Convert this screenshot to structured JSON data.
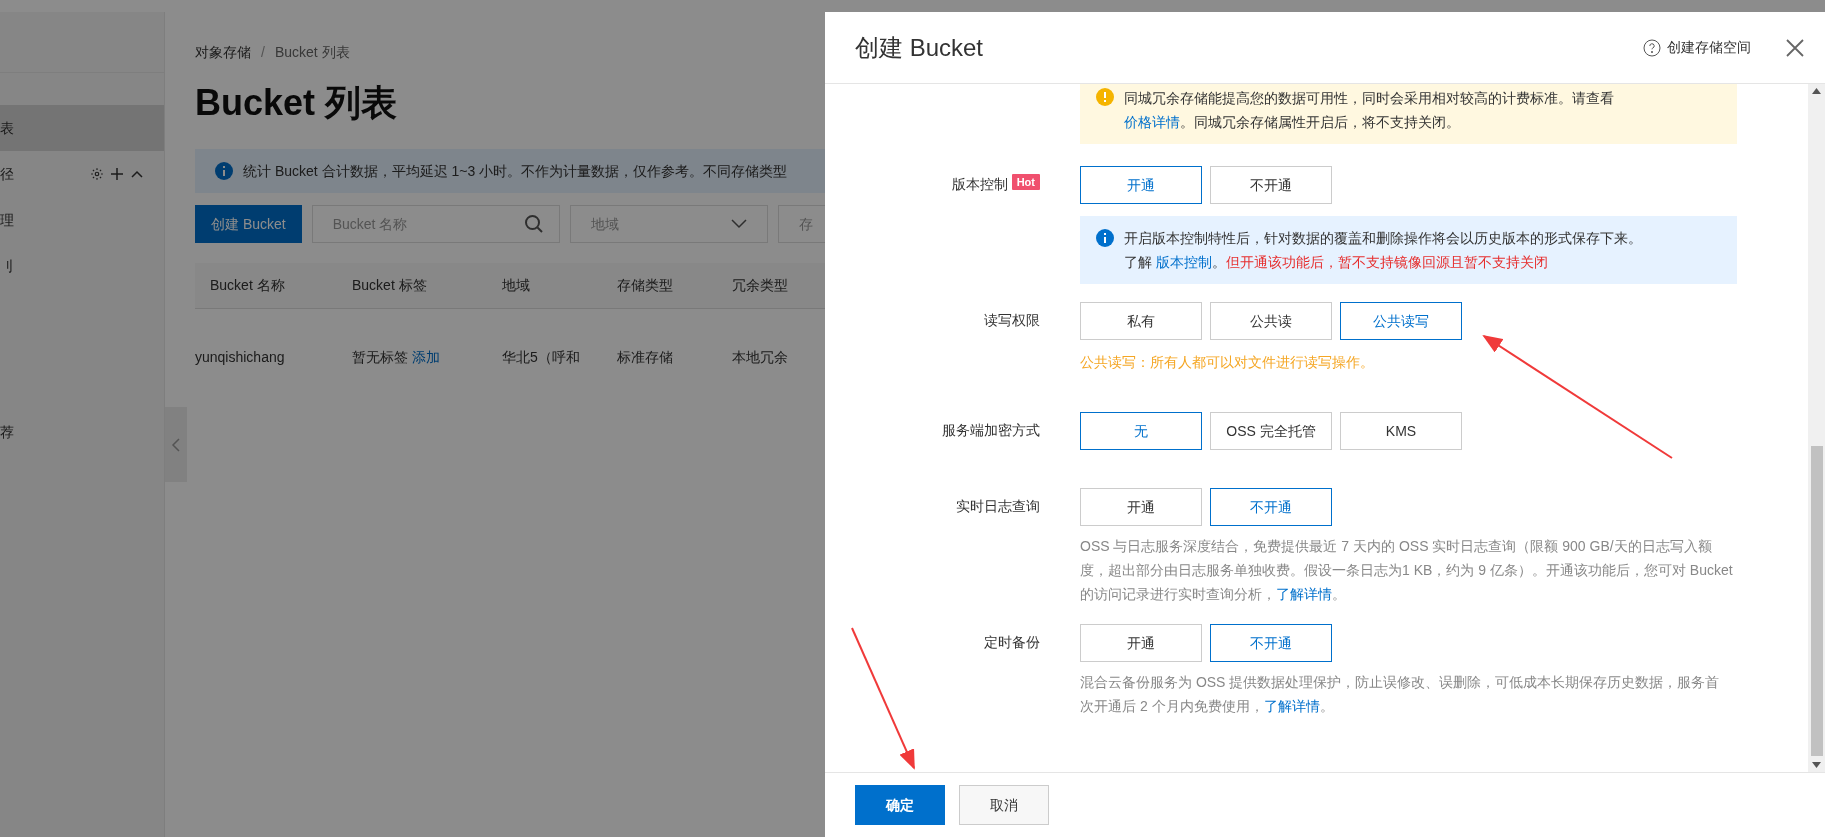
{
  "sidebar": {
    "items": [
      {
        "label": "表",
        "selected": true
      },
      {
        "label": "径",
        "selected": false,
        "kind": "group"
      },
      {
        "label": "理",
        "selected": false
      },
      {
        "label": "刂",
        "selected": false
      },
      {
        "label": "荐",
        "selected": false
      }
    ]
  },
  "breadcrumb": [
    "对象存储",
    "Bucket 列表"
  ],
  "breadcrumb_separator": "/",
  "page_title": "Bucket 列表",
  "notice": "统计 Bucket 合计数据，平均延迟 1~3 小时。不作为计量数据，仅作参考。不同存储类型",
  "toolbar": {
    "create_button": "创建 Bucket",
    "search": {
      "placeholder": "Bucket 名称"
    },
    "region_select": {
      "placeholder": "地域"
    },
    "storage_select": {
      "placeholder": "存"
    }
  },
  "table": {
    "columns": [
      "Bucket 名称",
      "Bucket 标签",
      "地域",
      "存储类型",
      "冗余类型"
    ],
    "rows": [
      {
        "name": "yunqishichang",
        "tag": "暂无标签",
        "tag_link": "添加",
        "region": "华北5（呼和",
        "storage": "标准存储",
        "redundancy": "本地冗余"
      }
    ]
  },
  "drawer": {
    "title": "创建 Bucket",
    "help_link": "创建存储空间",
    "warning": [
      {
        "kind": "plain",
        "text": "同城冗余存储能提高您的数据可用性，同时会采用相对较高的计费标准。请查看"
      },
      {
        "kind": "break"
      },
      {
        "kind": "link",
        "text": "价格详情"
      },
      {
        "kind": "plain",
        "text": "。同城冗余存储属性开启后，将不支持关闭。"
      }
    ],
    "rows": [
      {
        "label": "版本控制",
        "badge": "Hot",
        "options": [
          {
            "label": "开通",
            "selected": true
          },
          {
            "label": "不开通",
            "selected": false
          }
        ],
        "info": [
          {
            "kind": "plain",
            "text": "开启版本控制特性后，针对数据的覆盖和删除操作将会以历史版本的形式保存下来。"
          },
          {
            "kind": "break"
          },
          {
            "kind": "plain",
            "text": "了解 "
          },
          {
            "kind": "link",
            "text": "版本控制"
          },
          {
            "kind": "plain",
            "text": "。"
          },
          {
            "kind": "danger",
            "text": "但开通该功能后，暂不支持镜像回源且暂不支持关闭"
          }
        ]
      },
      {
        "label": "读写权限",
        "options": [
          {
            "label": "私有",
            "selected": false
          },
          {
            "label": "公共读",
            "selected": false
          },
          {
            "label": "公共读写",
            "selected": true
          }
        ],
        "hint": "公共读写：所有人都可以对文件进行读写操作。"
      },
      {
        "label": "服务端加密方式",
        "options": [
          {
            "label": "无",
            "selected": true
          },
          {
            "label": "OSS 完全托管",
            "selected": false
          },
          {
            "label": "KMS",
            "selected": false
          }
        ]
      },
      {
        "label": "实时日志查询",
        "options": [
          {
            "label": "开通",
            "selected": false
          },
          {
            "label": "不开通",
            "selected": true
          }
        ],
        "description": [
          {
            "kind": "plain",
            "text": "OSS 与日志服务深度结合，免费提供最近 7 天内的 OSS 实时日志查询（限额 900 GB/天的日志写入额度，超出部分由日志服务单独收费。假设一条日志为1 KB，约为 9 亿条）。开通该功能后，您可对 Bucket 的访问记录进行实时查询分析，"
          },
          {
            "kind": "link",
            "text": "了解详情"
          },
          {
            "kind": "plain",
            "text": "。"
          }
        ]
      },
      {
        "label": "定时备份",
        "options": [
          {
            "label": "开通",
            "selected": false
          },
          {
            "label": "不开通",
            "selected": true
          }
        ],
        "description": [
          {
            "kind": "plain",
            "text": "混合云备份服务为 OSS 提供数据处理保护，防止误修改、误删除，可低成本长期保存历史数据，服务首次开通后 2 个月内免费使用，"
          },
          {
            "kind": "link",
            "text": "了解详情"
          },
          {
            "kind": "plain",
            "text": "。"
          }
        ]
      }
    ],
    "footer": {
      "confirm": "确定",
      "cancel": "取消"
    }
  }
}
